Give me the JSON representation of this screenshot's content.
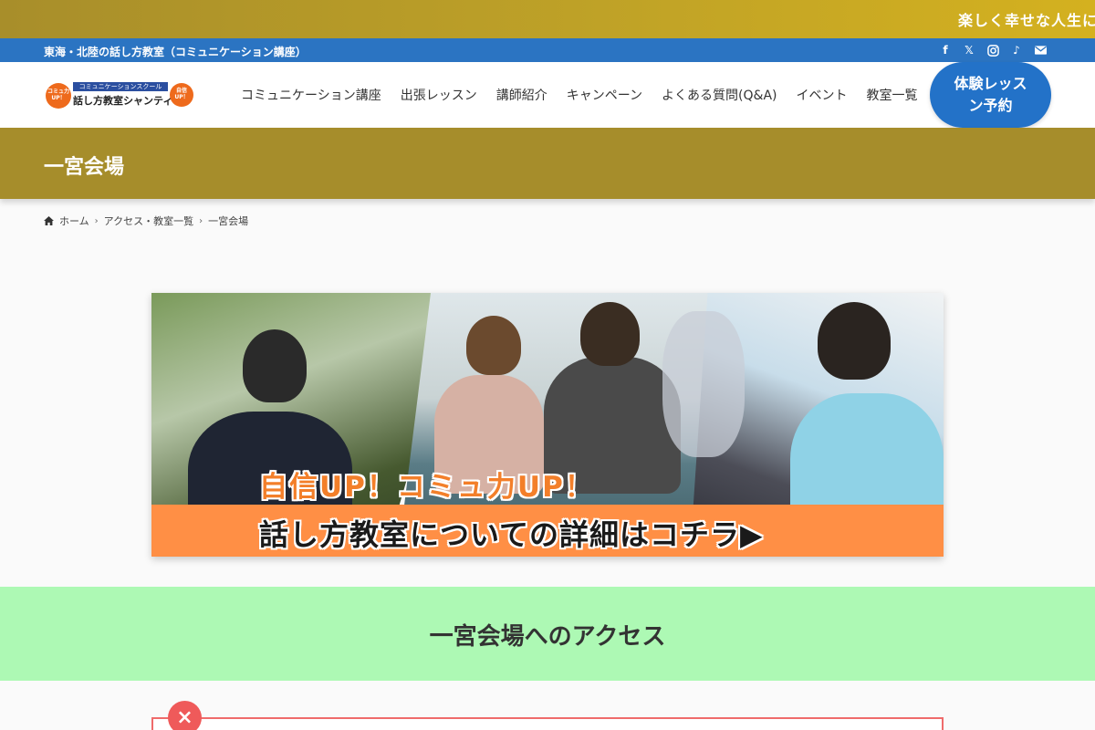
{
  "ticker": {
    "text": "楽しく幸せな人生に変"
  },
  "topbar": {
    "text": "東海・北陸の話し方教室（コミュニケーション講座）"
  },
  "social": [
    "facebook-icon",
    "x-icon",
    "instagram-icon",
    "tiktok-icon",
    "mail-icon"
  ],
  "logo": {
    "badge_left": "コミュ力 UP！",
    "small_text": "コミュニケーションスクール",
    "main_text": "話し方教室シャンティ",
    "badge_right": "自信 UP！"
  },
  "nav": {
    "items": [
      {
        "label": "コミュニケーション講座"
      },
      {
        "label": "出張レッスン"
      },
      {
        "label": "講師紹介"
      },
      {
        "label": "キャンペーン"
      },
      {
        "label": "よくある質問(Q&A)"
      },
      {
        "label": "イベント"
      },
      {
        "label": "教室一覧"
      }
    ],
    "cta": "体験レッスン予約"
  },
  "page": {
    "title": "一宮会場"
  },
  "breadcrumb": {
    "home": "ホーム",
    "parent": "アクセス・教室一覧",
    "current": "一宮会場"
  },
  "banner": {
    "headline": "自信UP！コミュ力UP！",
    "cta": "話し方教室についての詳細はコチラ▶"
  },
  "access": {
    "title": "一宮会場へのアクセス"
  },
  "notice": {
    "icon": "close-icon"
  },
  "colors": {
    "accent_gold": "#a68d2b",
    "topbar_blue": "#2b74c2",
    "cta_blue": "#2372c8",
    "banner_orange": "#ff8f45",
    "access_green": "#adf9b4",
    "notice_red": "#ef5a5a"
  }
}
